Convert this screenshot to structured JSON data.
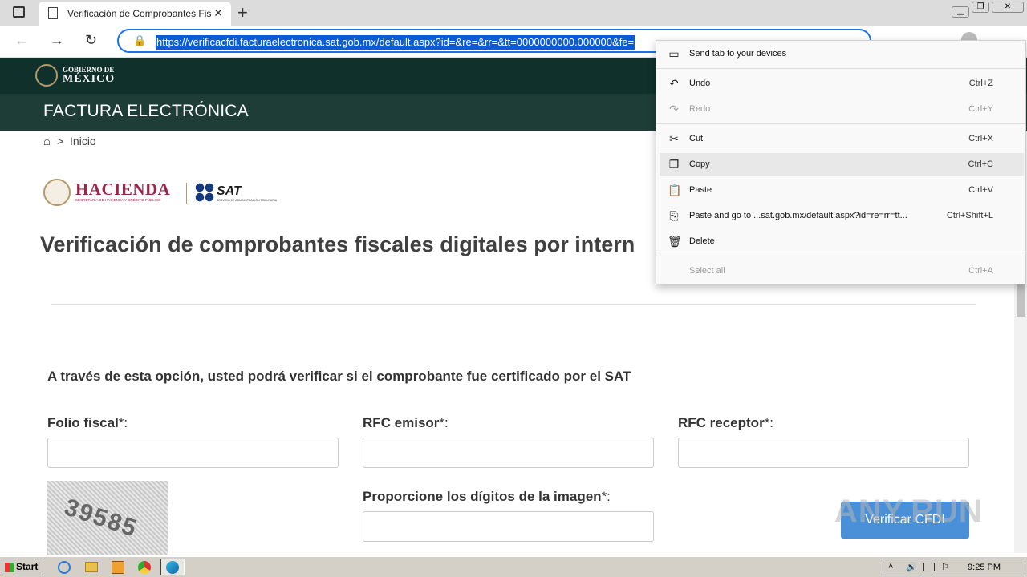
{
  "browser": {
    "tab_title": "Verificación de Comprobantes Fis",
    "url": "https://verificacfdi.facturaelectronica.sat.gob.mx/default.aspx?id=&re=&rr=&tt=0000000000.000000&fe="
  },
  "header": {
    "gov_line1": "GOBIERNO DE",
    "gov_line2": "MÉXICO",
    "site_title": "FACTURA ELECTRÓNICA"
  },
  "breadcrumb": {
    "separator": ">",
    "current": "Inicio"
  },
  "logos": {
    "hacienda_title": "HACIENDA",
    "hacienda_subtitle": "SECRETARÍA DE HACIENDA Y CRÉDITO PÚBLICO",
    "sat_title": "SAT",
    "sat_subtitle": "SERVICIO DE ADMINISTRACIÓN TRIBUTARIA"
  },
  "page": {
    "heading": "Verificación de comprobantes fiscales digitales por intern",
    "intro": "A través de esta opción, usted podrá verificar si el comprobante fue certificado por el SAT"
  },
  "form": {
    "folio_label": "Folio fiscal",
    "rfc_emisor_label": "RFC emisor",
    "rfc_receptor_label": "RFC receptor",
    "captcha_label": "Proporcione los dígitos de la imagen",
    "required_mark": "*:",
    "captcha_text": "39585",
    "verify_button": "Verificar CFDI"
  },
  "context_menu": {
    "send_tab": "Send tab to your devices",
    "undo": "Undo",
    "undo_sc": "Ctrl+Z",
    "redo": "Redo",
    "redo_sc": "Ctrl+Y",
    "cut": "Cut",
    "cut_sc": "Ctrl+X",
    "copy": "Copy",
    "copy_sc": "Ctrl+C",
    "paste": "Paste",
    "paste_sc": "Ctrl+V",
    "paste_go": "Paste and go to ...sat.gob.mx/default.aspx?id=re=rr=tt...",
    "paste_go_sc": "Ctrl+Shift+L",
    "delete": "Delete",
    "select_all": "Select all",
    "select_all_sc": "Ctrl+A"
  },
  "taskbar": {
    "start": "Start",
    "clock": "9:25 PM"
  },
  "watermark": "ANY.RUN"
}
